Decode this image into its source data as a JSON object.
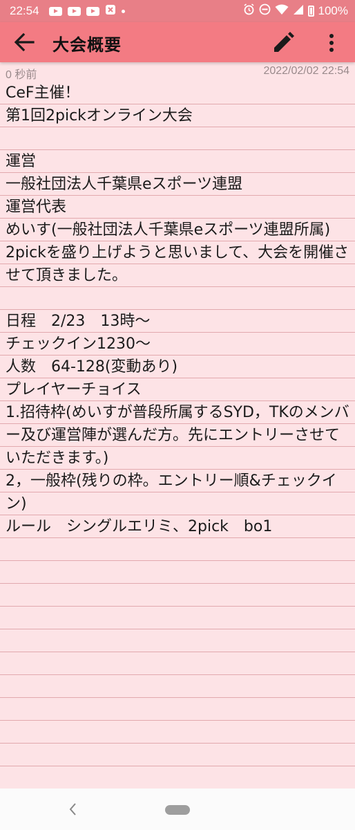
{
  "status_bar": {
    "time": "22:54",
    "battery_percent": "100%",
    "icons": [
      "youtube-icon",
      "youtube-icon",
      "youtube-icon",
      "app-icon",
      "notification-dot-icon",
      "alarm-icon",
      "do-not-disturb-icon",
      "wifi-icon",
      "signal-icon",
      "battery-icon"
    ]
  },
  "app_bar": {
    "title": "大会概要",
    "back_icon": "arrow-back-icon",
    "edit_icon": "pencil-icon",
    "more_icon": "more-vert-icon"
  },
  "meta": {
    "relative_time": "0 秒前",
    "timestamp": "2022/02/02 22:54"
  },
  "note": {
    "body": "CeF主催！\n第1回2pickオンライン大会\n\n運営\n一般社団法人千葉県eスポーツ連盟\n運営代表\nめいす(一般社団法人千葉県eスポーツ連盟所属)\n2pickを盛り上げようと思いまして、大会を開催させて頂きました。\n\n日程　2/23　13時〜\nチェックイン1230〜\n人数　64-128(変動あり)\nプレイヤーチョイス\n1.招待枠(めいすが普段所属するSYD，TKのメンバー及び運営陣が選んだ方。先にエントリーさせていただきます。)\n2，一般枠(残りの枠。エントリー順&チェックイン)\nルール　シングルエリミ、2pick　bo1"
  },
  "colors": {
    "status_bar": "#e87f87",
    "app_bar": "#f37b83",
    "note_background": "#fde3e6",
    "rule_line": "#e2a9ae",
    "text": "#1b1b1b"
  }
}
